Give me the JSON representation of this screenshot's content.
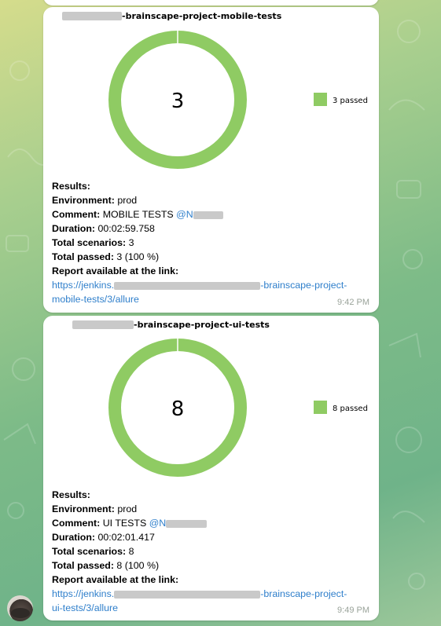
{
  "colors": {
    "passed": "#8fcb63",
    "link": "#2f7fcb",
    "time": "#9aa39a"
  },
  "messages": [
    {
      "chart": {
        "title_suffix": "-brainscape-project-mobile-tests",
        "center_value": "3",
        "legend": "3 passed"
      },
      "chart_data": {
        "type": "pie",
        "categories": [
          "passed"
        ],
        "values": [
          3
        ],
        "legend_position": "right"
      },
      "results_label": "Results:",
      "env_label": "Environment:",
      "env_value": "prod",
      "comment_label": "Comment:",
      "comment_value": "MOBILE TESTS",
      "comment_mention": "@N",
      "duration_label": "Duration:",
      "duration_value": "00:02:59.758",
      "scenarios_label": "Total scenarios:",
      "scenarios_value": "3",
      "passed_label": "Total passed:",
      "passed_value": "3 (100 %)",
      "report_label": "Report available at the link:",
      "link_prefix": "https://jenkins.",
      "link_suffix": "-brainscape-project-",
      "link_line2": "mobile-tests/3/allure",
      "time": "9:42 PM"
    },
    {
      "chart": {
        "title_suffix": "-brainscape-project-ui-tests",
        "center_value": "8",
        "legend": "8 passed"
      },
      "chart_data": {
        "type": "pie",
        "categories": [
          "passed"
        ],
        "values": [
          8
        ],
        "legend_position": "right"
      },
      "results_label": "Results:",
      "env_label": "Environment:",
      "env_value": "prod",
      "comment_label": "Comment:",
      "comment_value": "UI TESTS",
      "comment_mention": "@N",
      "duration_label": "Duration:",
      "duration_value": "00:02:01.417",
      "scenarios_label": "Total scenarios:",
      "scenarios_value": "8",
      "passed_label": "Total passed:",
      "passed_value": "8 (100 %)",
      "report_label": "Report available at the link:",
      "link_prefix": "https://jenkins.",
      "link_suffix": "-brainscape-project-",
      "link_line2": "ui-tests/3/allure",
      "time": "9:49 PM"
    }
  ]
}
